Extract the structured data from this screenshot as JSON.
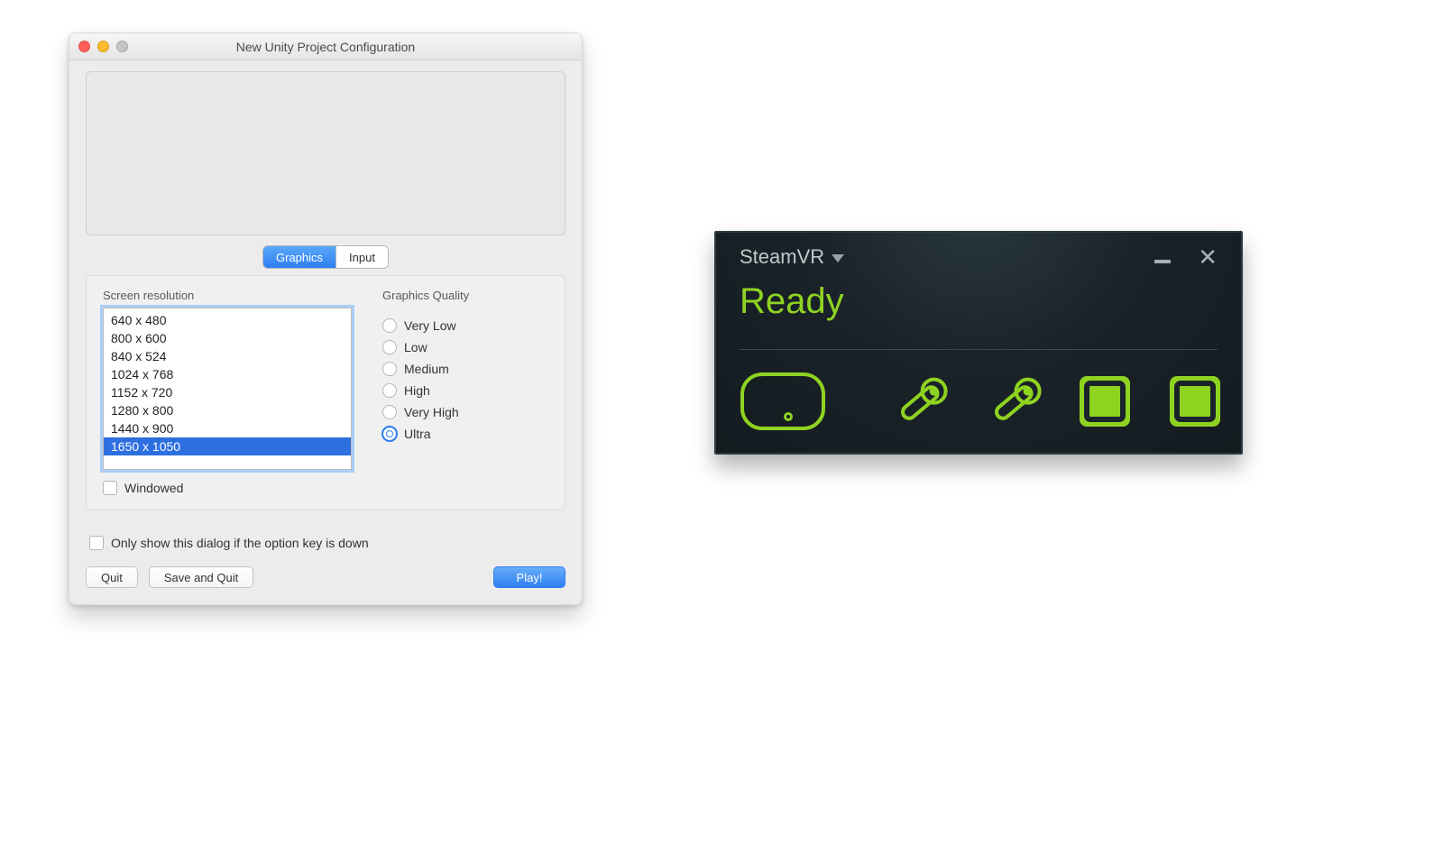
{
  "unity": {
    "title": "New Unity Project Configuration",
    "tabs": {
      "graphics": "Graphics",
      "input": "Input",
      "active": "graphics"
    },
    "resolution": {
      "label": "Screen resolution",
      "options": [
        "640 x 480",
        "800 x 600",
        "840 x 524",
        "1024 x 768",
        "1152 x 720",
        "1280 x 800",
        "1440 x 900",
        "1650 x 1050"
      ],
      "selected": "1650 x 1050"
    },
    "quality": {
      "label": "Graphics Quality",
      "options": [
        "Very Low",
        "Low",
        "Medium",
        "High",
        "Very High",
        "Ultra"
      ],
      "selected": "Ultra"
    },
    "windowed_label": "Windowed",
    "windowed_checked": false,
    "show_dialog_label": "Only show this dialog if the option key is down",
    "show_dialog_checked": false,
    "buttons": {
      "quit": "Quit",
      "save_quit": "Save and Quit",
      "play": "Play!"
    }
  },
  "steamvr": {
    "title": "SteamVR",
    "status": "Ready",
    "devices": [
      "hmd",
      "controller",
      "controller",
      "lighthouse",
      "lighthouse"
    ],
    "accent": "#8fd321"
  }
}
